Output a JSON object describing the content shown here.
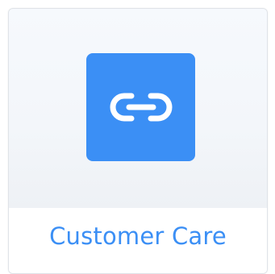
{
  "card": {
    "label": "Customer Care",
    "icon": "link-icon",
    "tile_color": "#3b8ff5",
    "label_color": "#3b8ff5"
  }
}
